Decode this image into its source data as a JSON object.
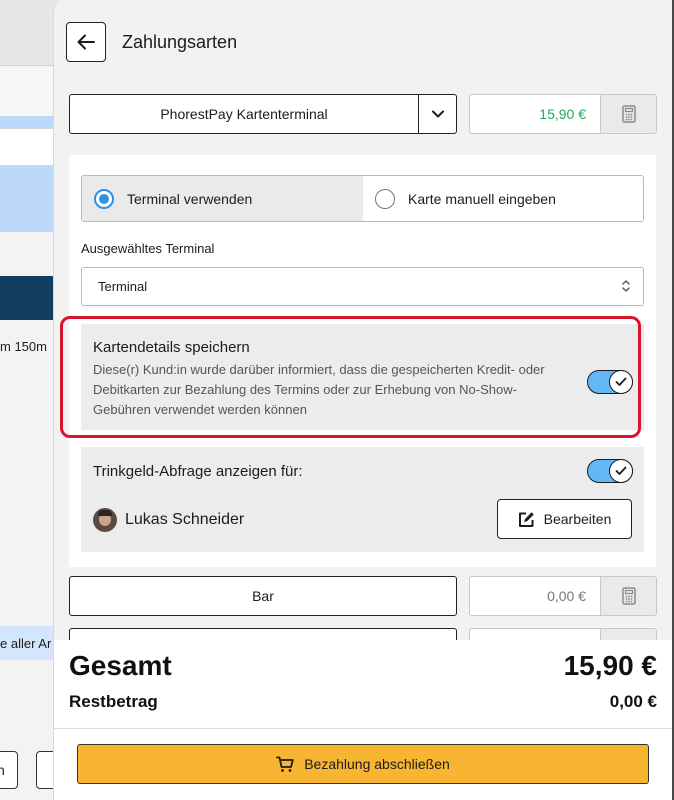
{
  "background": {
    "row_text": "m 150m",
    "blue_row_text": "e aller Ar",
    "bottom_button_text": "n"
  },
  "header": {
    "title": "Zahlungsarten"
  },
  "payment_methods": [
    {
      "label": "PhorestPay Kartenterminal",
      "amount": "15,90 €",
      "has_dropdown": true
    },
    {
      "label": "Bar",
      "amount": "0,00 €",
      "has_dropdown": false
    }
  ],
  "card_options": {
    "mode_options": [
      {
        "label": "Terminal verwenden",
        "selected": true
      },
      {
        "label": "Karte manuell eingeben",
        "selected": false
      }
    ],
    "terminal_label": "Ausgewähltes Terminal",
    "terminal_value": "Terminal"
  },
  "save_card": {
    "title": "Kartendetails speichern",
    "description": "Diese(r) Kund:in wurde darüber informiert, dass die gespeicherten Kredit- oder Debitkarten zur Bezahlung des Termins oder zur Erhebung von No-Show-Gebühren verwendet werden können",
    "enabled": true
  },
  "tip_prompt": {
    "title": "Trinkgeld-Abfrage anzeigen für:",
    "enabled": true,
    "staff_name": "Lukas Schneider",
    "edit_label": "Bearbeiten"
  },
  "summary": {
    "total_label": "Gesamt",
    "total_value": "15,90 €",
    "remaining_label": "Restbetrag",
    "remaining_value": "0,00 €"
  },
  "actions": {
    "complete_payment_label": "Bezahlung abschließen"
  },
  "colors": {
    "accent_blue": "#2a92e8",
    "toggle_on": "#62b7f5",
    "amount_green": "#27a85a",
    "primary_button": "#f8b531",
    "highlight_red": "#d8152a"
  },
  "icons": {
    "back": "arrow-left-icon",
    "dropdown": "chevron-down-icon",
    "calculator": "calculator-icon",
    "select": "chevron-up-down-icon",
    "toggle_check": "check-icon",
    "edit": "edit-icon",
    "cart": "cart-icon"
  }
}
